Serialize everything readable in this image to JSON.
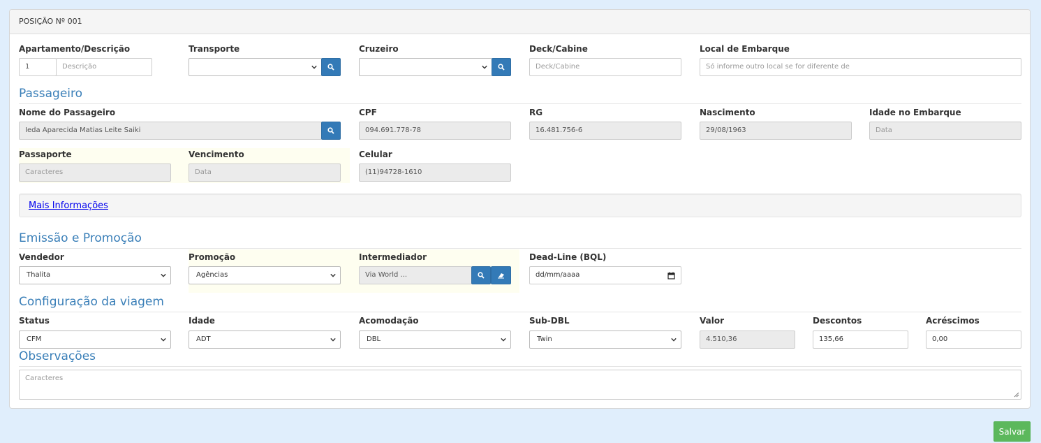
{
  "panel": {
    "heading": "POSIÇÃO Nº 001"
  },
  "row1": {
    "apartamento_label": "Apartamento/Descrição",
    "apartamento_value": "1",
    "descricao_placeholder": "Descrição",
    "transporte_label": "Transporte",
    "transporte_value": "",
    "cruzeiro_label": "Cruzeiro",
    "cruzeiro_value": "",
    "deck_label": "Deck/Cabine",
    "deck_placeholder": "Deck/Cabine",
    "local_label": "Local de Embarque",
    "local_placeholder": "Só informe outro local se for diferente de"
  },
  "passageiro": {
    "title": "Passageiro",
    "nome_label": "Nome do Passageiro",
    "nome_value": "Ieda Aparecida Matias Leite Saiki",
    "cpf_label": "CPF",
    "cpf_value": "094.691.778-78",
    "rg_label": "RG",
    "rg_value": "16.481.756-6",
    "nascimento_label": "Nascimento",
    "nascimento_value": "29/08/1963",
    "idade_label": "Idade no Embarque",
    "idade_placeholder": "Data",
    "passaporte_label": "Passaporte",
    "passaporte_placeholder": "Caracteres",
    "vencimento_label": "Vencimento",
    "vencimento_placeholder": "Data",
    "celular_label": "Celular",
    "celular_value": "(11)94728-1610"
  },
  "mais_info": {
    "link": "Mais Informações"
  },
  "emissao": {
    "title": "Emissão e Promoção",
    "vendedor_label": "Vendedor",
    "vendedor_value": "Thalita",
    "promocao_label": "Promoção",
    "promocao_value": "Agências",
    "intermediador_label": "Intermediador",
    "intermediador_value": "Via World ...",
    "deadline_label": "Dead-Line (BQL)",
    "deadline_value": "dd/mm/aaaa"
  },
  "config": {
    "title": "Configuração da viagem",
    "status_label": "Status",
    "status_value": "CFM",
    "idade_label": "Idade",
    "idade_value": "ADT",
    "acomodacao_label": "Acomodação",
    "acomodacao_value": "DBL",
    "subdbl_label": "Sub-DBL",
    "subdbl_value": "Twin",
    "valor_label": "Valor",
    "valor_value": "4.510,36",
    "descontos_label": "Descontos",
    "descontos_value": "135,66",
    "acrescimos_label": "Acréscimos",
    "acrescimos_value": "0,00"
  },
  "observacoes": {
    "title": "Observações",
    "placeholder": "Caracteres"
  },
  "actions": {
    "save_label": "Salvar"
  },
  "colors": {
    "primary": "#337ab7",
    "section_title": "#3a7fb8",
    "success": "#5cb85c",
    "page_bg": "#e0eefc",
    "highlight": "#fefef0"
  }
}
